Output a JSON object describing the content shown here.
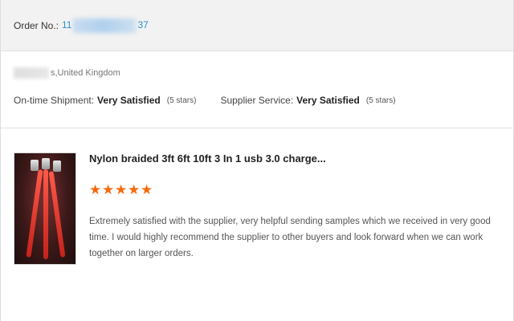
{
  "order": {
    "label": "Order No.:",
    "number_prefix": "11",
    "number_suffix": "37"
  },
  "buyer": {
    "location": "s,United Kingdom"
  },
  "ratings": {
    "shipment_label": "On-time Shipment:",
    "shipment_value": "Very Satisfied",
    "shipment_stars": "(5 stars)",
    "service_label": "Supplier Service:",
    "service_value": "Very Satisfied",
    "service_stars": "(5 stars)"
  },
  "review": {
    "product_title": "Nylon braided 3ft 6ft 10ft 3 In 1 usb 3.0 charge...",
    "rating": 5,
    "rating_max": 5,
    "star_color": "#f46a0d",
    "text": "Extremely satisfied with the supplier, very helpful sending samples which we received in very good time. I would highly recommend the supplier to other buyers and look forward when we can work together on larger orders."
  },
  "colors": {
    "order_number": "#2a8fd8",
    "header_bg": "#f2f2f2"
  }
}
